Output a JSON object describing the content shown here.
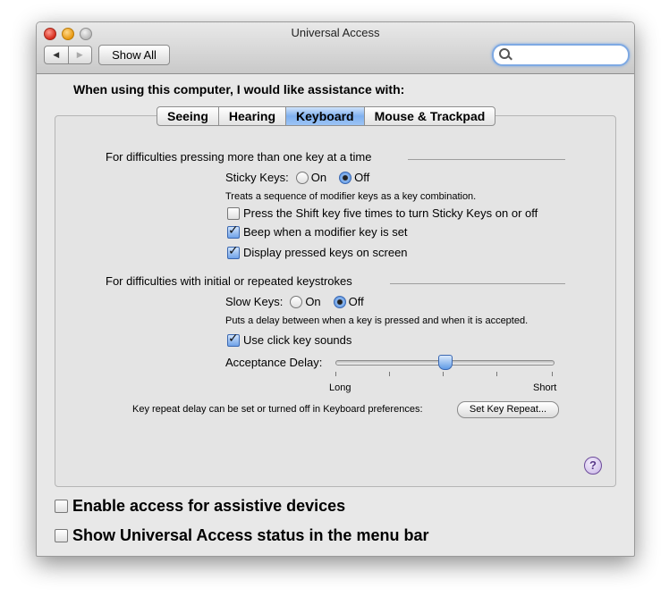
{
  "window": {
    "title": "Universal Access"
  },
  "toolbar": {
    "back_label": "◀",
    "forward_label": "▶",
    "show_all_label": "Show All",
    "search_value": ""
  },
  "heading": "When using this computer, I would like assistance with:",
  "tabs": [
    {
      "label": "Seeing",
      "active": false
    },
    {
      "label": "Hearing",
      "active": false
    },
    {
      "label": "Keyboard",
      "active": true
    },
    {
      "label": "Mouse & Trackpad",
      "active": false
    }
  ],
  "group1": {
    "title": "For difficulties pressing more than one key at a time",
    "sticky_label": "Sticky Keys:",
    "on_label": "On",
    "off_label": "Off",
    "selected": "Off",
    "description": "Treats a sequence of modifier keys as a key combination.",
    "options": [
      {
        "label": "Press the Shift key five times to turn Sticky Keys on or off",
        "checked": false
      },
      {
        "label": "Beep when a modifier key is set",
        "checked": true
      },
      {
        "label": "Display pressed keys on screen",
        "checked": true
      }
    ]
  },
  "group2": {
    "title": "For difficulties with initial or repeated keystrokes",
    "slow_label": "Slow Keys:",
    "on_label": "On",
    "off_label": "Off",
    "selected": "Off",
    "description": "Puts a delay between when a key is pressed and when it is accepted.",
    "click_sounds": {
      "label": "Use click key sounds",
      "checked": true
    },
    "delay_label": "Acceptance Delay:",
    "delay_value": 0.5,
    "long_label": "Long",
    "short_label": "Short",
    "repeat_text": "Key repeat delay can be set or turned off in Keyboard preferences:",
    "repeat_button": "Set Key Repeat..."
  },
  "help_label": "?",
  "bottom": [
    {
      "label": "Enable access for assistive devices",
      "checked": false
    },
    {
      "label": "Show Universal Access status in the menu bar",
      "checked": false
    }
  ]
}
